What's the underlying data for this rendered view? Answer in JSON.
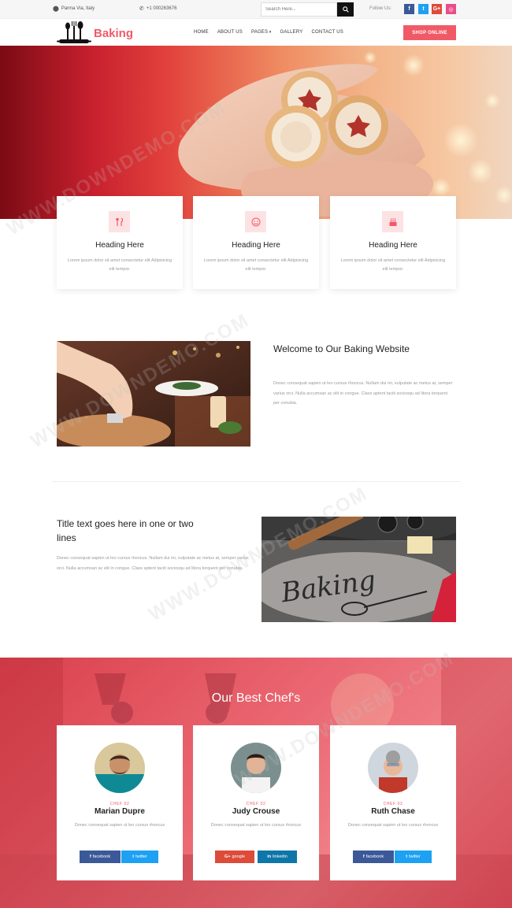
{
  "topbar": {
    "location": "Parma Via, Italy",
    "phone": "+1 000263676",
    "search_placeholder": "Search Here...",
    "follow_label": "Follow Us:",
    "social": [
      {
        "icon": "facebook-icon",
        "glyph": "f",
        "color": "#3b5998"
      },
      {
        "icon": "twitter-icon",
        "glyph": "t",
        "color": "#1da1f2"
      },
      {
        "icon": "google-plus-icon",
        "glyph": "G+",
        "color": "#dd4b39"
      },
      {
        "icon": "dribbble-icon",
        "glyph": "◎",
        "color": "#ea4c89"
      }
    ]
  },
  "header": {
    "logo_text": "Baking",
    "nav": [
      "HOME",
      "ABOUT US",
      "PAGES",
      "GALLERY",
      "CONTACT US"
    ],
    "shop_button": "SHOP ONLINE"
  },
  "features": [
    {
      "icon": "utensils-icon",
      "heading": "Heading Here",
      "text": "Lorem ipsum dolor sit amet consectetur elit Adipisicing elit tempor."
    },
    {
      "icon": "smile-icon",
      "heading": "Heading Here",
      "text": "Lorem ipsum dolor sit amet consectetur elit Adipisicing elit tempor."
    },
    {
      "icon": "cake-icon",
      "heading": "Heading Here",
      "text": "Lorem ipsum dolor sit amet consectetur elit Adipisicing elit tempor."
    }
  ],
  "welcome": {
    "title": "Welcome to Our Baking Website",
    "text": "Donec consequat sapien ut leo cursus rhoncus. Nullam dui mi, vulputate ac metus at, semper varius orci. Nulla accumsan ac elit in congue. Class aptent taciti sociosqu ad litora torquent per conubia."
  },
  "section2": {
    "title": "Title text goes here in one or two lines",
    "text": "Donec consequat sapien ut leo cursus rhoncus. Nullam dui mi, vulputate ac metus at, semper varius orci. Nulla accumsan ac elit in congue. Class aptent taciti sociosqu ad litora torquent per conubia.",
    "image_text": "Baking"
  },
  "chefs": {
    "title": "Our Best Chef's",
    "items": [
      {
        "role": "CHEF 02",
        "name": "Marian Dupre",
        "desc": "Donec consequat sapien ut leo cursus rhoncus",
        "buttons": [
          {
            "icon": "facebook-icon",
            "glyph": "f",
            "label": "facebook",
            "color": "#3b5998"
          },
          {
            "icon": "twitter-icon",
            "glyph": "t",
            "label": "twitter",
            "color": "#1da1f2"
          }
        ]
      },
      {
        "role": "CHEF 02",
        "name": "Judy Crouse",
        "desc": "Donec consequat sapien ut leo cursus rhoncus",
        "buttons": [
          {
            "icon": "google-plus-icon",
            "glyph": "G+",
            "label": "google",
            "color": "#dd4b39"
          },
          {
            "icon": "linkedin-icon",
            "glyph": "in",
            "label": "linkedin",
            "color": "#0e76a8"
          }
        ]
      },
      {
        "role": "CHEF 02",
        "name": "Ruth Chase",
        "desc": "Donec consequat sapien ut leo cursus rhoncus",
        "buttons": [
          {
            "icon": "facebook-icon",
            "glyph": "f",
            "label": "facebook",
            "color": "#3b5998"
          },
          {
            "icon": "twitter-icon",
            "glyph": "t",
            "label": "twitter",
            "color": "#1da1f2"
          }
        ]
      }
    ]
  },
  "watermark": "WWW.DOWNDEMO.COM",
  "colors": {
    "accent": "#f05a67",
    "accent_light": "#fde2e4"
  }
}
